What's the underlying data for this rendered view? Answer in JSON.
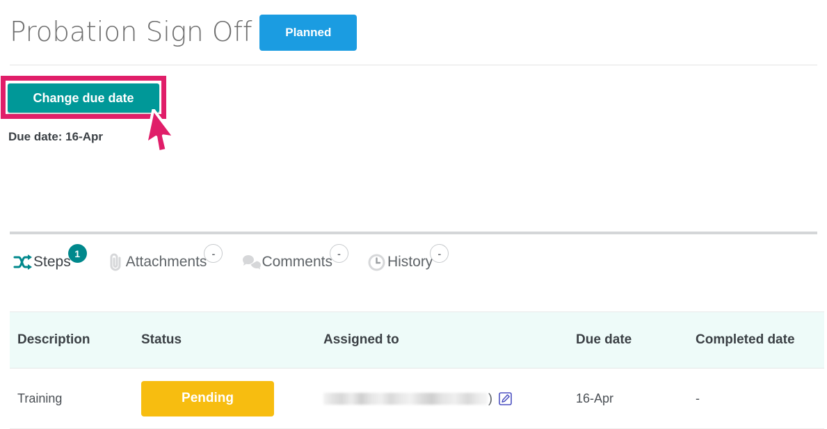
{
  "header": {
    "title": "Probation Sign Off",
    "status_label": "Planned",
    "status_color": "#1b9ce1"
  },
  "actions": {
    "change_due_date_label": "Change due date",
    "change_due_date_color": "#009898",
    "highlight_color": "#e01e69",
    "due_date_text": "Due date: 16-Apr"
  },
  "tabs": [
    {
      "label": "Steps",
      "icon": "shuffle-icon",
      "badge": "1",
      "badge_style": "filled",
      "active": true
    },
    {
      "label": "Attachments",
      "icon": "paperclip-icon",
      "badge": "-",
      "badge_style": "outline",
      "active": false
    },
    {
      "label": "Comments",
      "icon": "comment-icon",
      "badge": "-",
      "badge_style": "outline",
      "active": false
    },
    {
      "label": "History",
      "icon": "clock-icon",
      "badge": "-",
      "badge_style": "outline",
      "active": false
    }
  ],
  "table": {
    "columns": [
      "Description",
      "Status",
      "Assigned to",
      "Due date",
      "Completed date"
    ],
    "rows": [
      {
        "description": "Training",
        "status": "Pending",
        "status_color": "#f7bd10",
        "assigned_to": "",
        "assigned_to_suffix": ")",
        "edit_icon": "edit-pencil-icon",
        "due_date": "16-Apr",
        "completed_date": "-"
      }
    ]
  }
}
